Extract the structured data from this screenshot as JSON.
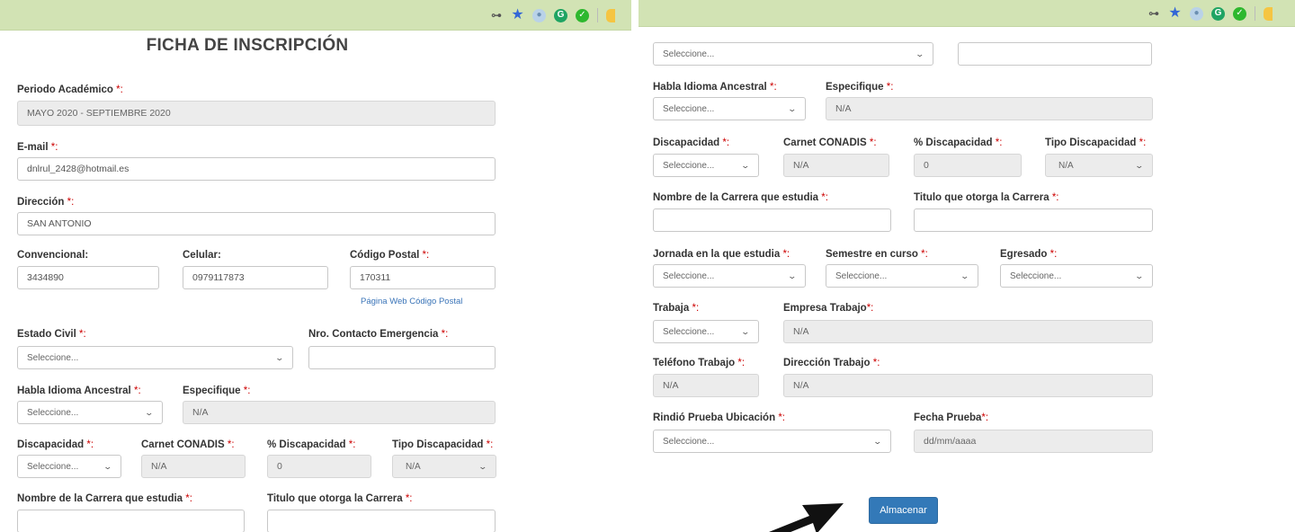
{
  "left": {
    "title": "FICHA DE INSCRIPCIÓN",
    "periodo": {
      "label": "Periodo Académico",
      "value": "MAYO 2020 - SEPTIEMBRE 2020"
    },
    "email": {
      "label": "E-mail",
      "value": "dnlrul_2428@hotmail.es"
    },
    "direccion": {
      "label": "Dirección",
      "value": "SAN ANTONIO"
    },
    "convencional": {
      "label": "Convencional:",
      "value": "3434890"
    },
    "celular": {
      "label": "Celular:",
      "value": "0979117873"
    },
    "codigo_postal": {
      "label": "Código Postal",
      "value": "170311"
    },
    "codigo_link": "Página Web Código Postal",
    "estado_civil": {
      "label": "Estado Civil",
      "value": "Seleccione..."
    },
    "contacto": {
      "label": "Nro. Contacto Emergencia",
      "value": ""
    },
    "idioma": {
      "label": "Habla Idioma Ancestral",
      "value": "Seleccione..."
    },
    "especifique": {
      "label": "Especifique",
      "value": "N/A"
    },
    "discapacidad": {
      "label": "Discapacidad",
      "value": "Seleccione..."
    },
    "carnet": {
      "label": "Carnet CONADIS",
      "value": "N/A"
    },
    "porcentaje": {
      "label": "% Discapacidad",
      "value": "0"
    },
    "tipo": {
      "label": "Tipo Discapacidad",
      "value": "N/A"
    },
    "carrera": {
      "label": "Nombre de la Carrera que estudia",
      "value": ""
    },
    "titulo": {
      "label": "Titulo que otorga la Carrera",
      "value": ""
    }
  },
  "right": {
    "top_select": {
      "value": "Seleccione..."
    },
    "idioma": {
      "label": "Habla Idioma Ancestral",
      "value": "Seleccione..."
    },
    "especifique": {
      "label": "Especifique",
      "value": "N/A"
    },
    "discapacidad": {
      "label": "Discapacidad",
      "value": "Seleccione..."
    },
    "carnet": {
      "label": "Carnet CONADIS",
      "value": "N/A"
    },
    "porcentaje": {
      "label": "% Discapacidad",
      "value": "0"
    },
    "tipo": {
      "label": "Tipo Discapacidad",
      "value": "N/A"
    },
    "carrera": {
      "label": "Nombre de la Carrera que estudia",
      "value": ""
    },
    "titulo": {
      "label": "Titulo que otorga la Carrera",
      "value": ""
    },
    "jornada": {
      "label": "Jornada en la que estudia",
      "value": "Seleccione..."
    },
    "semestre": {
      "label": "Semestre en curso",
      "value": "Seleccione..."
    },
    "egresado": {
      "label": "Egresado",
      "value": "Seleccione..."
    },
    "trabaja": {
      "label": "Trabaja",
      "value": "Seleccione..."
    },
    "empresa": {
      "label": "Empresa Trabajo",
      "value": "N/A"
    },
    "telefono": {
      "label": "Teléfono Trabajo",
      "value": "N/A"
    },
    "direccion_trabajo": {
      "label": "Dirección Trabajo",
      "value": "N/A"
    },
    "prueba": {
      "label": "Rindió Prueba Ubicación",
      "value": "Seleccione..."
    },
    "fecha": {
      "label": "Fecha Prueba",
      "value": "dd/mm/aaaa"
    },
    "submit": "Almacenar"
  },
  "required_marker": "*:",
  "required_marker_nocolon": "*",
  "chev": "⌄",
  "colors": {
    "accent": "#3379b8",
    "required": "#cc0000",
    "chrome": "#d2e3b4",
    "arrow": "#111111"
  }
}
